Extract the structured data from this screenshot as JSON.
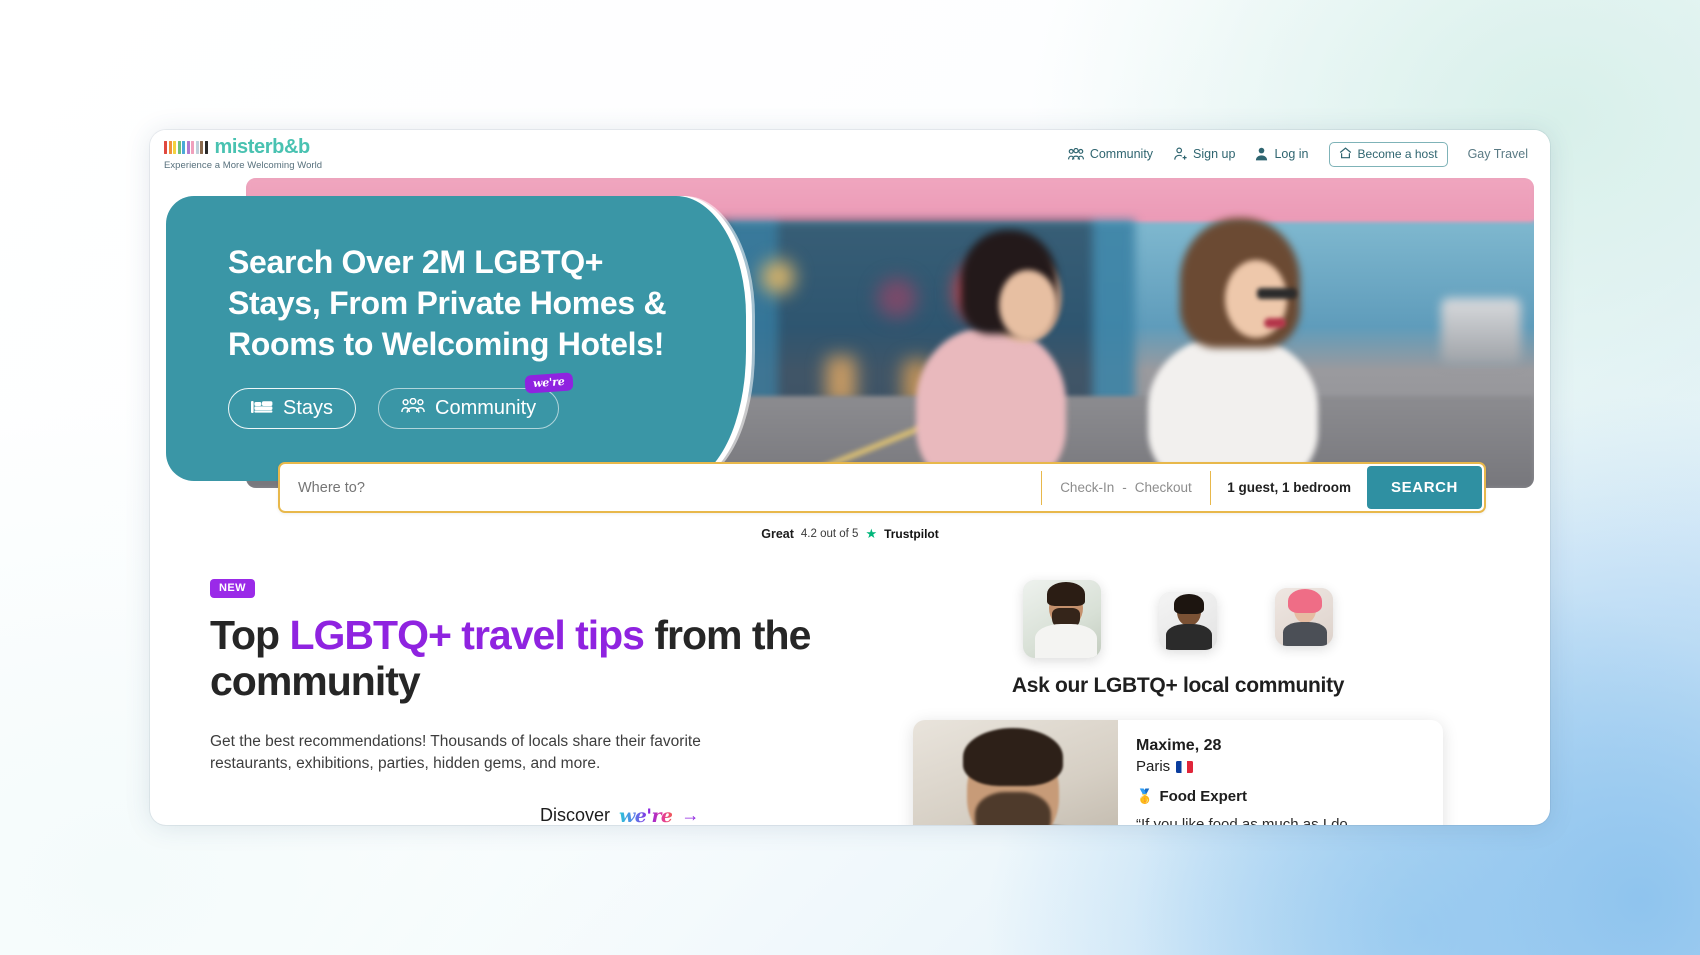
{
  "brand": {
    "name": "misterb&b",
    "tagline": "Experience a More Welcoming World",
    "accent_teal": "#3a96a6",
    "logo_green": "#49c2b1",
    "accent_purple": "#8f23e0",
    "search_border": "#e8b84b"
  },
  "nav": {
    "items": [
      {
        "label": "Community",
        "icon": "people-icon"
      },
      {
        "label": "Sign up",
        "icon": "person-add-icon"
      },
      {
        "label": "Log in",
        "icon": "person-icon"
      }
    ],
    "host_button": {
      "label": "Become a host",
      "icon": "home-icon"
    },
    "gay_travel": "Gay Travel"
  },
  "hero": {
    "title": "Search Over 2M LGBTQ+ Stays, From Private Homes & Rooms to Welcoming Hotels!",
    "toggles": [
      {
        "label": "Stays",
        "icon": "bed-icon",
        "active": true
      },
      {
        "label": "Community",
        "icon": "people-icon",
        "active": false,
        "badge": "we're"
      }
    ]
  },
  "search": {
    "where_placeholder": "Where to?",
    "where_value": "",
    "checkin_label": "Check-In",
    "dash": "-",
    "checkout_label": "Checkout",
    "guests_label": "1 guest, 1 bedroom",
    "button_label": "SEARCH"
  },
  "trustpilot": {
    "verdict": "Great",
    "score_text": "4.2 out of 5",
    "star": "★",
    "brand": "Trustpilot"
  },
  "tips": {
    "badge": "NEW",
    "heading_part1": "Top ",
    "heading_highlight": "LGBTQ+ travel tips",
    "heading_part2": " from the community",
    "body": "Get the best recommendations! Thousands of locals share their favorite restaurants, exhibitions, parties, hidden gems, and more.",
    "discover_label": "Discover",
    "discover_wordmark": "we're",
    "discover_arrow": "→"
  },
  "community": {
    "heading": "Ask our LGBTQ+ local community",
    "avatars": [
      {
        "name": "avatar-bearded-man"
      },
      {
        "name": "avatar-laughing-person"
      },
      {
        "name": "avatar-pink-hair-person"
      }
    ],
    "profile": {
      "name_age": "Maxime, 28",
      "city": "Paris",
      "flag": "🇫🇷",
      "expert_icon": "medal-icon",
      "expert_label": "Food Expert",
      "quote": "“If you like food as much as I do,"
    }
  }
}
